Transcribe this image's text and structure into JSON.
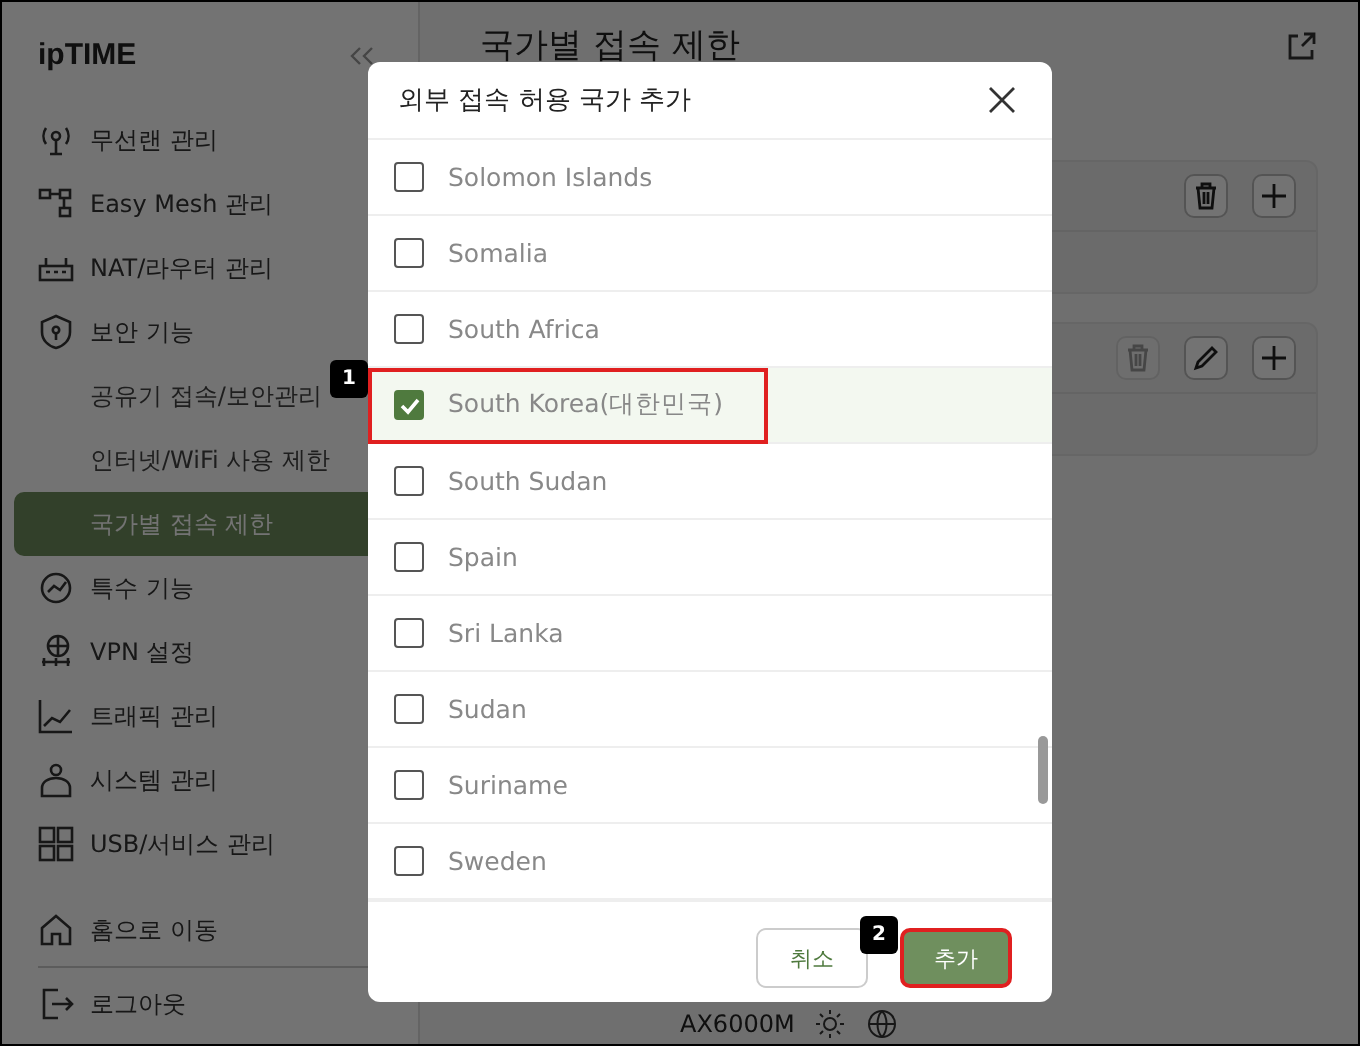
{
  "sidebar": {
    "logo": "ipTIME",
    "items": [
      {
        "label": "무선랜 관리"
      },
      {
        "label": "Easy Mesh 관리"
      },
      {
        "label": "NAT/라우터 관리"
      },
      {
        "label": "보안 기능",
        "children": [
          {
            "label": "공유기 접속/보안관리",
            "selected": false
          },
          {
            "label": "인터넷/WiFi 사용 제한",
            "selected": false
          },
          {
            "label": "국가별 접속 제한",
            "selected": true
          }
        ]
      },
      {
        "label": "특수 기능"
      },
      {
        "label": "VPN 설정"
      },
      {
        "label": "트래픽 관리"
      },
      {
        "label": "시스템 관리"
      },
      {
        "label": "USB/서비스 관리"
      }
    ],
    "bottom_items": [
      {
        "label": "홈으로 이동"
      },
      {
        "label": "로그아웃"
      }
    ]
  },
  "main": {
    "title": "국가별 접속 제한",
    "cards": [
      {
        "buttons": [
          {
            "kind": "delete",
            "disabled": false
          },
          {
            "kind": "add",
            "disabled": false
          }
        ]
      },
      {
        "buttons": [
          {
            "kind": "delete",
            "disabled": true
          },
          {
            "kind": "edit",
            "disabled": false
          },
          {
            "kind": "add",
            "disabled": false
          }
        ]
      }
    ],
    "footer": {
      "model": "AX6000M"
    }
  },
  "dialog": {
    "title": "외부 접속 허용 국가 추가",
    "countries": [
      {
        "name": "Solomon Islands",
        "checked": false
      },
      {
        "name": "Somalia",
        "checked": false
      },
      {
        "name": "South Africa",
        "checked": false
      },
      {
        "name": "South Korea(대한민국)",
        "checked": true,
        "callout": "1"
      },
      {
        "name": "South Sudan",
        "checked": false
      },
      {
        "name": "Spain",
        "checked": false
      },
      {
        "name": "Sri Lanka",
        "checked": false
      },
      {
        "name": "Sudan",
        "checked": false
      },
      {
        "name": "Suriname",
        "checked": false
      },
      {
        "name": "Sweden",
        "checked": false
      }
    ],
    "buttons": [
      {
        "label": "취소",
        "kind": "cancel"
      },
      {
        "label": "추가",
        "kind": "primary",
        "callout": "2"
      }
    ]
  }
}
